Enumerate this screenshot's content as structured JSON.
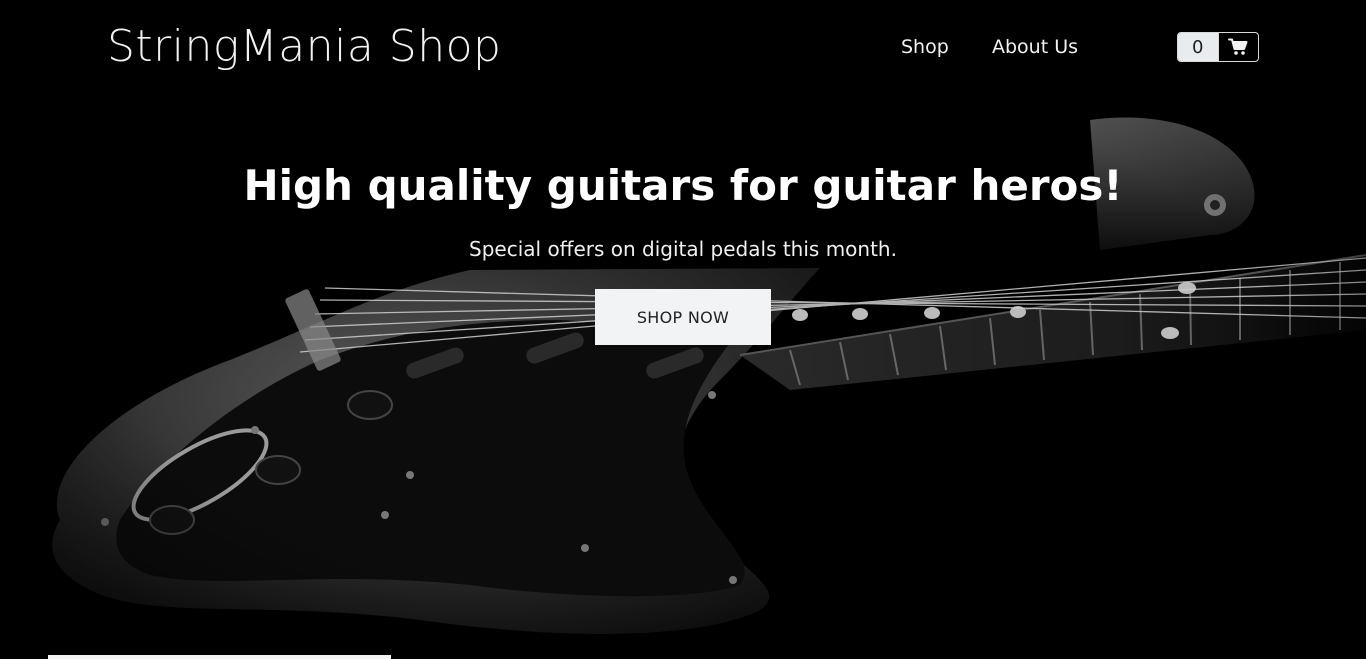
{
  "navbar": {
    "brand": "StringMania Shop",
    "links": [
      {
        "label": "Shop"
      },
      {
        "label": "About Us"
      }
    ],
    "cart": {
      "count": "0",
      "icon": "shopping-cart-icon"
    }
  },
  "hero": {
    "title": "High quality guitars for guitar heros!",
    "subtitle": "Special offers on digital pedals this month.",
    "cta_label": "SHOP NOW",
    "background_image": "black-and-white-electric-guitar-photo"
  },
  "colors": {
    "background": "#000000",
    "text": "#ffffff",
    "button_bg": "#f1f3f5",
    "button_text": "#222222"
  }
}
